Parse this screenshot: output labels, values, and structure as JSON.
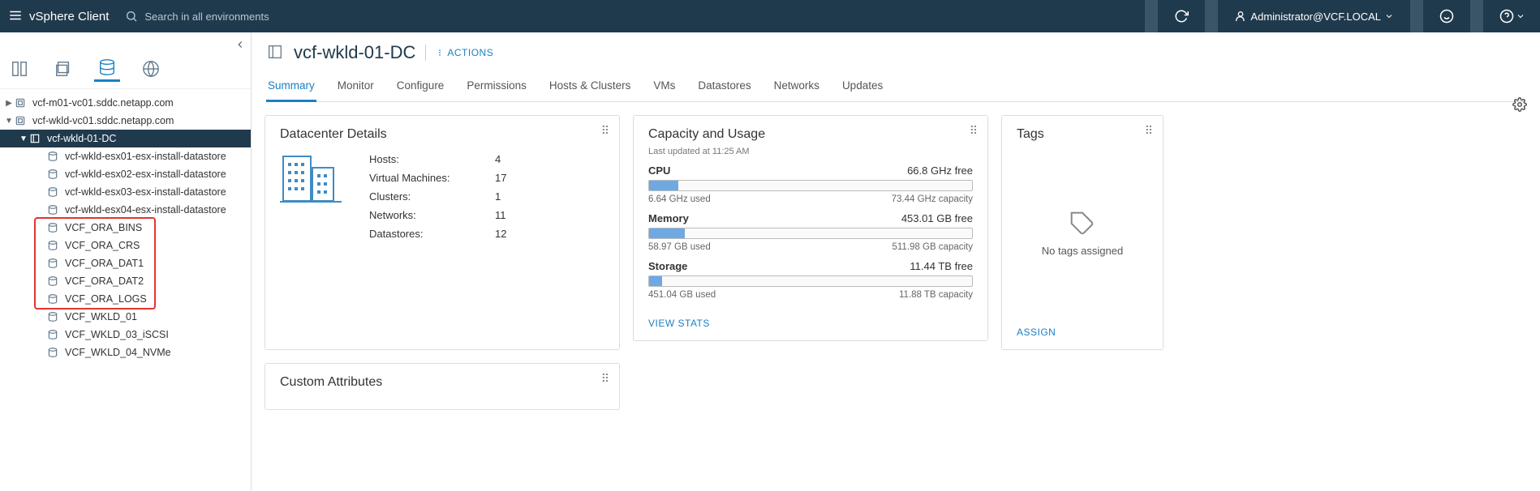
{
  "topbar": {
    "brand": "vSphere Client",
    "search_placeholder": "Search in all environments",
    "user": "Administrator@VCF.LOCAL"
  },
  "tree": {
    "vc1": "vcf-m01-vc01.sddc.netapp.com",
    "vc2": "vcf-wkld-vc01.sddc.netapp.com",
    "dc": "vcf-wkld-01-DC",
    "datastores": [
      "vcf-wkld-esx01-esx-install-datastore",
      "vcf-wkld-esx02-esx-install-datastore",
      "vcf-wkld-esx03-esx-install-datastore",
      "vcf-wkld-esx04-esx-install-datastore",
      "VCF_ORA_BINS",
      "VCF_ORA_CRS",
      "VCF_ORA_DAT1",
      "VCF_ORA_DAT2",
      "VCF_ORA_LOGS",
      "VCF_WKLD_01",
      "VCF_WKLD_03_iSCSI",
      "VCF_WKLD_04_NVMe"
    ]
  },
  "header": {
    "title": "vcf-wkld-01-DC",
    "actions": "ACTIONS"
  },
  "tabs": [
    "Summary",
    "Monitor",
    "Configure",
    "Permissions",
    "Hosts & Clusters",
    "VMs",
    "Datastores",
    "Networks",
    "Updates"
  ],
  "dc_card": {
    "title": "Datacenter Details",
    "rows": {
      "hosts_k": "Hosts:",
      "hosts_v": "4",
      "vms_k": "Virtual Machines:",
      "vms_v": "17",
      "clusters_k": "Clusters:",
      "clusters_v": "1",
      "networks_k": "Networks:",
      "networks_v": "11",
      "datastores_k": "Datastores:",
      "datastores_v": "12"
    }
  },
  "cap_card": {
    "title": "Capacity and Usage",
    "subtitle": "Last updated at 11:25 AM",
    "cpu": {
      "label": "CPU",
      "free": "66.8 GHz free",
      "used": "6.64 GHz used",
      "capacity": "73.44 GHz capacity",
      "pct": 9
    },
    "mem": {
      "label": "Memory",
      "free": "453.01 GB free",
      "used": "58.97 GB used",
      "capacity": "511.98 GB capacity",
      "pct": 11
    },
    "sto": {
      "label": "Storage",
      "free": "11.44 TB free",
      "used": "451.04 GB used",
      "capacity": "11.88 TB capacity",
      "pct": 4
    },
    "link": "VIEW STATS"
  },
  "tags_card": {
    "title": "Tags",
    "empty": "No tags assigned",
    "link": "ASSIGN"
  },
  "cust_card": {
    "title": "Custom Attributes"
  }
}
